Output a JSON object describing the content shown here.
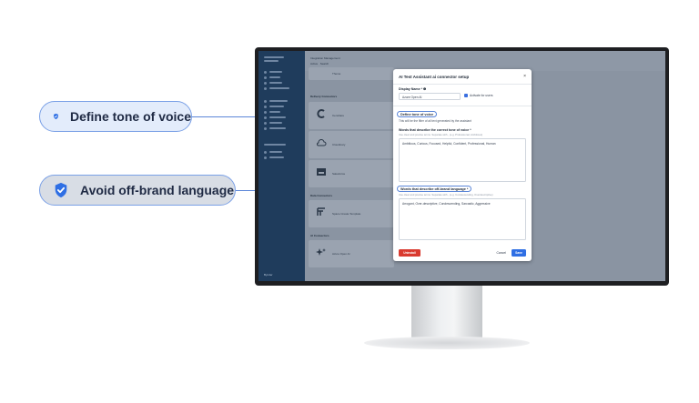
{
  "callouts": [
    {
      "label": "Define tone of voice",
      "icon": "shield-check-icon"
    },
    {
      "label": "Avoid off-brand language",
      "icon": "shield-check-icon"
    }
  ],
  "app": {
    "breadcrumb": "Integration Management",
    "tabs": [
      "Active",
      "Search"
    ],
    "first_item": "Theme",
    "sections": [
      "Delivery Connectors",
      "Data Connectors",
      "AI Connectors"
    ],
    "delivery_items": [
      "Censhare",
      "Cloudinary",
      "Salesforce"
    ],
    "data_items": [
      "Space Create Template"
    ],
    "ai_items": [
      "Azure Open AI"
    ],
    "footer": "Bynder"
  },
  "modal": {
    "title": "AI Test Assistant ai connector setup",
    "close": "×",
    "display_name_label": "Display Name * ❶",
    "display_name_value": "Azure Open AI",
    "activate_label": "Activate for users",
    "tone_pill": "Define tone of voice",
    "tone_desc": "This will be the filter of all text generated by the assistant",
    "tone_words_label": "Words that describe the correct tone of voice *",
    "tone_words_hint": "Use clear and precise terms. Separate with , (e.g. Professional, Ambitious)",
    "tone_words_value": "Ambitious, Curious, Focused, Helpful, Confident, Professional, Human",
    "offbrand_pill": "Words that describe off-brand language *",
    "offbrand_hint": "Use clear and precise terms. Separate with , (e.g. Condescending, Overdescriptive)",
    "offbrand_value": "Arrogant, Over-descriptive, Condescending, Sarcastic, Aggressive",
    "uninstall_label": "Uninstall",
    "cancel_label": "Cancel",
    "save_label": "Save"
  },
  "colors": {
    "accent": "#2f6fe4",
    "danger": "#d93a2f",
    "callout_border": "#7aa0e6"
  }
}
